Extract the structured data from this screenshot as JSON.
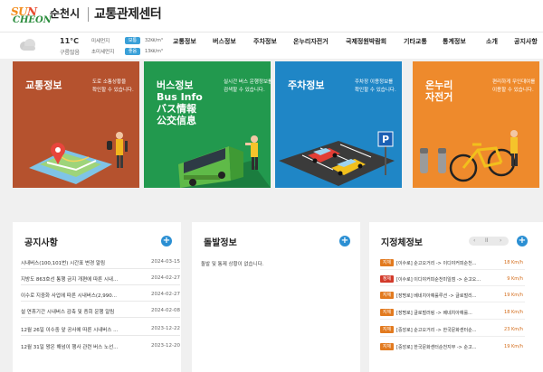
{
  "header": {
    "logo_sun": "SUN",
    "logo_cheon": "CHEON",
    "logo_sub": "순천시",
    "city_name": "순천시",
    "site_name": "교통관제센터"
  },
  "weather": {
    "temperature": "11°C",
    "sky": "구름많음",
    "fine_dust_label": "미세먼지",
    "fine_dust_status": "보통",
    "fine_dust_value": "32㏍/m³",
    "ultra_dust_label": "초미세먼지",
    "ultra_dust_status": "좋음",
    "ultra_dust_value": "13㏍/m³"
  },
  "nav": {
    "items": [
      "교통정보",
      "버스정보",
      "주차정보",
      "온누리자전거",
      "국제정원박람회",
      "기타교통",
      "통계정보",
      "소개",
      "공지사항"
    ]
  },
  "cards": [
    {
      "title": "교통정보",
      "desc": "도로 소통상황을\n확인할 수 있습니다.",
      "color": "#b5522e"
    },
    {
      "title": "버스정보\nBus Info\nバス情報\n公交信息",
      "desc": "실시간 버스 운행정보를\n검색할 수 있습니다.",
      "color": "#22994e"
    },
    {
      "title": "주차정보",
      "desc": "주차장 이용정보를\n확인할 수 있습니다.",
      "color": "#1f86c6"
    },
    {
      "title": "온누리\n자전거",
      "desc": "편리하게 무인대여를\n이용할 수 있습니다.",
      "color": "#ee8a2c"
    }
  ],
  "notice": {
    "title": "공지사항",
    "items": [
      {
        "text": "시내버스(100,101번) 시간표 변경 알림",
        "date": "2024-03-15"
      },
      {
        "text": "지방도 863호선 통행 금지 개편에 따른 시내...",
        "date": "2024-02-27"
      },
      {
        "text": "이수로 지중화 사업에 따른 시내버스(2,990...",
        "date": "2024-02-27"
      },
      {
        "text": "설 연휴기간 시내버스 감축 및 증회 운행 알림",
        "date": "2024-02-08"
      },
      {
        "text": "12월 26일 이수중 앞 공사에 따른 시내버스 ...",
        "date": "2023-12-22"
      },
      {
        "text": "12월 31일 왕온 해넘이 행사 관련 버스 노선...",
        "date": "2023-12-20"
      }
    ]
  },
  "incident": {
    "title": "돌발정보",
    "empty_message": "돌발 및 통제 상황이 없습니다."
  },
  "speed": {
    "title": "지정체정보",
    "prev": "‹",
    "pause": "II",
    "next": "›",
    "items": [
      {
        "status": "지체",
        "road": "[이수로] 순고오거리 -> 이디야커피순천...",
        "speed": "18 Km/h",
        "color": "#e27a1f"
      },
      {
        "status": "정체",
        "road": "[이수로] 이디야커피순천미일점 -> 순고오...",
        "speed": "9 Km/h",
        "color": "#d23a2a"
      },
      {
        "status": "지체",
        "road": "[장명로] 베네치아예룰루션 -> 글로벌리...",
        "speed": "19 Km/h",
        "color": "#e27a1f"
      },
      {
        "status": "지체",
        "road": "[장명로] 글로벌러링 -> 베네치아예룰...",
        "speed": "18 Km/h",
        "color": "#e27a1f"
      },
      {
        "status": "지체",
        "road": "[중앙로] 순고오거리 -> 한국문화센터순...",
        "speed": "23 Km/h",
        "color": "#e27a1f"
      },
      {
        "status": "지체",
        "road": "[중앙로] 한국문화센터순천지부 -> 순고...",
        "speed": "19 Km/h",
        "color": "#e27a1f"
      }
    ]
  },
  "colors": {
    "fine_dust_badge": "#3aa0d8",
    "ultra_dust_badge": "#3aa0d8",
    "plus_button": "#2b8fd3"
  }
}
